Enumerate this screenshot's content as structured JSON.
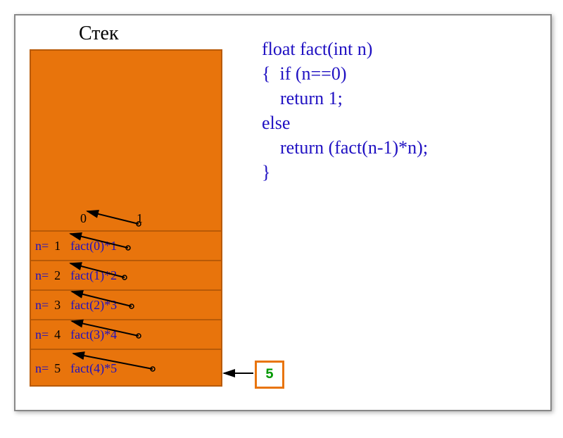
{
  "title": "Стек",
  "code_lines": "float fact(int n)\n{  if (n==0)\n    return 1;\nelse\n    return (fact(n-1)*n);\n}",
  "top": {
    "zero": "0",
    "one": "1"
  },
  "rows": [
    {
      "label": "n=",
      "val": "1",
      "calc": "fact(0)*1"
    },
    {
      "label": "n=",
      "val": "2",
      "calc": "fact(1)*2"
    },
    {
      "label": "n=",
      "val": "3",
      "calc": "fact(2)*3"
    },
    {
      "label": "n=",
      "val": "4",
      "calc": "fact(3)*4"
    },
    {
      "label": "n=",
      "val": "5",
      "calc": "fact(4)*5"
    }
  ],
  "result": "5"
}
